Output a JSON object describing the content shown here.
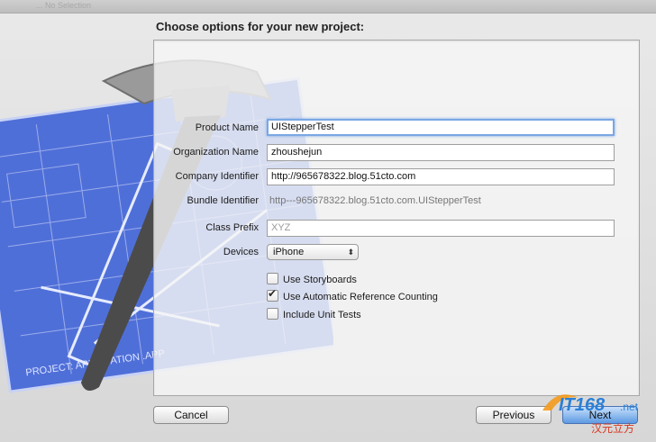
{
  "window": {
    "faint_title": "... No Selection"
  },
  "dialog": {
    "heading": "Choose options for your new project:",
    "fields": {
      "product_name": {
        "label": "Product Name",
        "value": "UIStepperTest"
      },
      "organization_name": {
        "label": "Organization Name",
        "value": "zhoushejun"
      },
      "company_identifier": {
        "label": "Company Identifier",
        "value": "http://965678322.blog.51cto.com"
      },
      "bundle_identifier": {
        "label": "Bundle Identifier",
        "value": "http---965678322.blog.51cto.com.UIStepperTest"
      },
      "class_prefix": {
        "label": "Class Prefix",
        "placeholder": "XYZ"
      },
      "devices": {
        "label": "Devices",
        "value": "iPhone"
      }
    },
    "options": {
      "storyboards": {
        "label": "Use Storyboards",
        "checked": false
      },
      "arc": {
        "label": "Use Automatic Reference Counting",
        "checked": true
      },
      "unit_tests": {
        "label": "Include Unit Tests",
        "checked": false
      }
    },
    "buttons": {
      "cancel": "Cancel",
      "previous": "Previous",
      "next": "Next"
    },
    "art_text": {
      "caption": "PROJECT: APPLICATION .APP"
    }
  },
  "watermark": {
    "logo": "IT168.net",
    "chinese": "汉元立方"
  },
  "colors": {
    "focus": "#7aa7e4",
    "blueprint": "#4f6fd8",
    "primary_button": "#5d9be3"
  },
  "icons": {
    "checkbox": "checkbox-icon",
    "popup": "popup-arrows-icon",
    "art": "hammer-blueprint-icon"
  }
}
